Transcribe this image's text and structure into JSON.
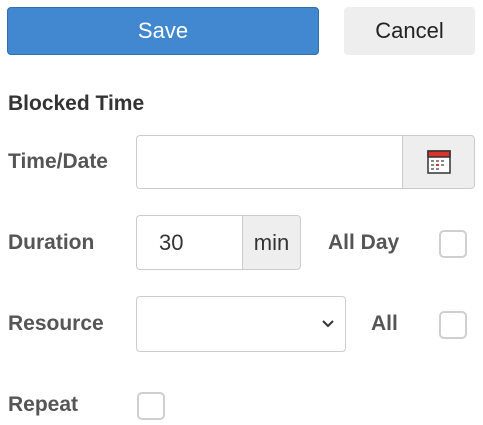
{
  "toolbar": {
    "save_label": "Save",
    "cancel_label": "Cancel"
  },
  "section": {
    "title": "Blocked Time"
  },
  "fields": {
    "time_date": {
      "label": "Time/Date",
      "value": "",
      "icon": "calendar-icon"
    },
    "duration": {
      "label": "Duration",
      "value": "30",
      "unit": "min"
    },
    "all_day": {
      "label": "All Day",
      "checked": false
    },
    "resource": {
      "label": "Resource",
      "selected": "",
      "icon": "chevron-down-icon"
    },
    "all": {
      "label": "All",
      "checked": false
    },
    "repeat": {
      "label": "Repeat",
      "checked": false
    }
  },
  "colors": {
    "primary": "#4188d0",
    "secondary": "#eeeeee",
    "label": "#555555"
  }
}
